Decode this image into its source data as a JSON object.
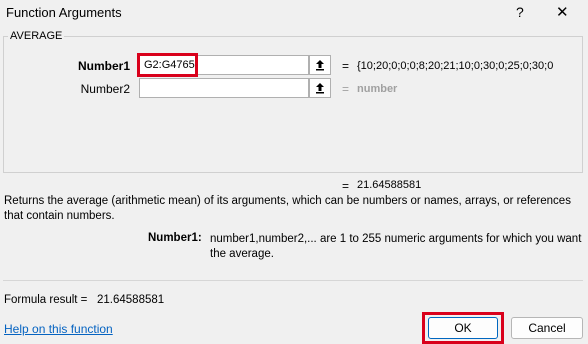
{
  "dialog": {
    "title": "Function Arguments",
    "help_glyph": "?",
    "close_glyph": "✕"
  },
  "function_name": "AVERAGE",
  "args": [
    {
      "label": "Number1",
      "value": "G2:G4765",
      "result": "{10;20;0;0;0;8;20;21;10;0;30;0;25;0;30;0"
    },
    {
      "label": "Number2",
      "value": "",
      "result": "number"
    }
  ],
  "equals": "=",
  "total_result": "21.64588581",
  "description": "Returns the average (arithmetic mean) of its arguments, which can be numbers or names, arrays, or references that contain numbers.",
  "arg_help": {
    "name": "Number1:",
    "text": "number1,number2,... are 1 to 255 numeric arguments for which you want the average."
  },
  "formula_result": {
    "label": "Formula result =",
    "value": "21.64588581"
  },
  "help_link": "Help on this function",
  "buttons": {
    "ok": "OK",
    "cancel": "Cancel"
  },
  "icons": {
    "help": "question-icon",
    "close": "close-icon",
    "collapse": "collapse-dialog-icon"
  },
  "colors": {
    "highlight": "#d9001b",
    "link": "#0563c1",
    "dialog_bg": "#f0f0f0"
  }
}
